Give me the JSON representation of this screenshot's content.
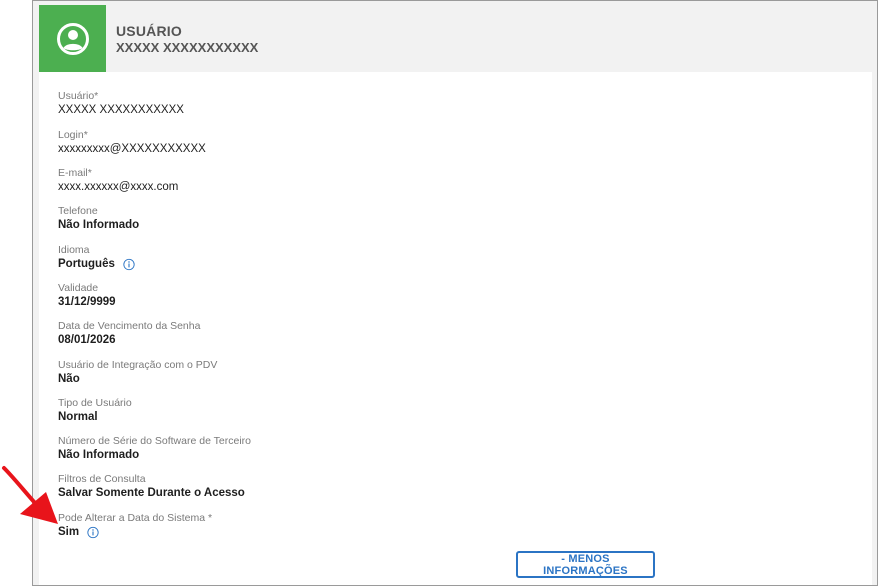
{
  "header": {
    "title": "USUÁRIO",
    "subtitle": "XXXXX XXXXXXXXXXX",
    "icon": "user-circle-icon",
    "icon_color": "#4caf50"
  },
  "fields": [
    {
      "label": "Usuário*",
      "value": "XXXXX XXXXXXXXXXX"
    },
    {
      "label": "Login*",
      "value": "xxxxxxxxx@XXXXXXXXXXX"
    },
    {
      "label": "E-mail*",
      "value": "xxxx.xxxxxx@xxxx.com"
    },
    {
      "label": "Telefone",
      "value": "Não Informado"
    },
    {
      "label": "Idioma",
      "value": "Português"
    },
    {
      "label": "Validade",
      "value": "31/12/9999"
    },
    {
      "label": "Data de Vencimento da Senha",
      "value": "08/01/2026"
    },
    {
      "label": "Usuário de Integração com o PDV",
      "value": "Não"
    },
    {
      "label": "Tipo de Usuário",
      "value": "Normal"
    },
    {
      "label": "Número de Série do Software de Terceiro",
      "value": "Não Informado"
    },
    {
      "label": "Filtros de Consulta",
      "value": "Salvar Somente Durante o Acesso"
    },
    {
      "label": "Pode Alterar a Data do Sistema *",
      "value": "Sim"
    }
  ],
  "buttons": {
    "less_info": "- MENOS INFORMAÇÕES"
  },
  "colors": {
    "accent": "#2b74c4",
    "annotation_arrow": "#e8141b"
  }
}
